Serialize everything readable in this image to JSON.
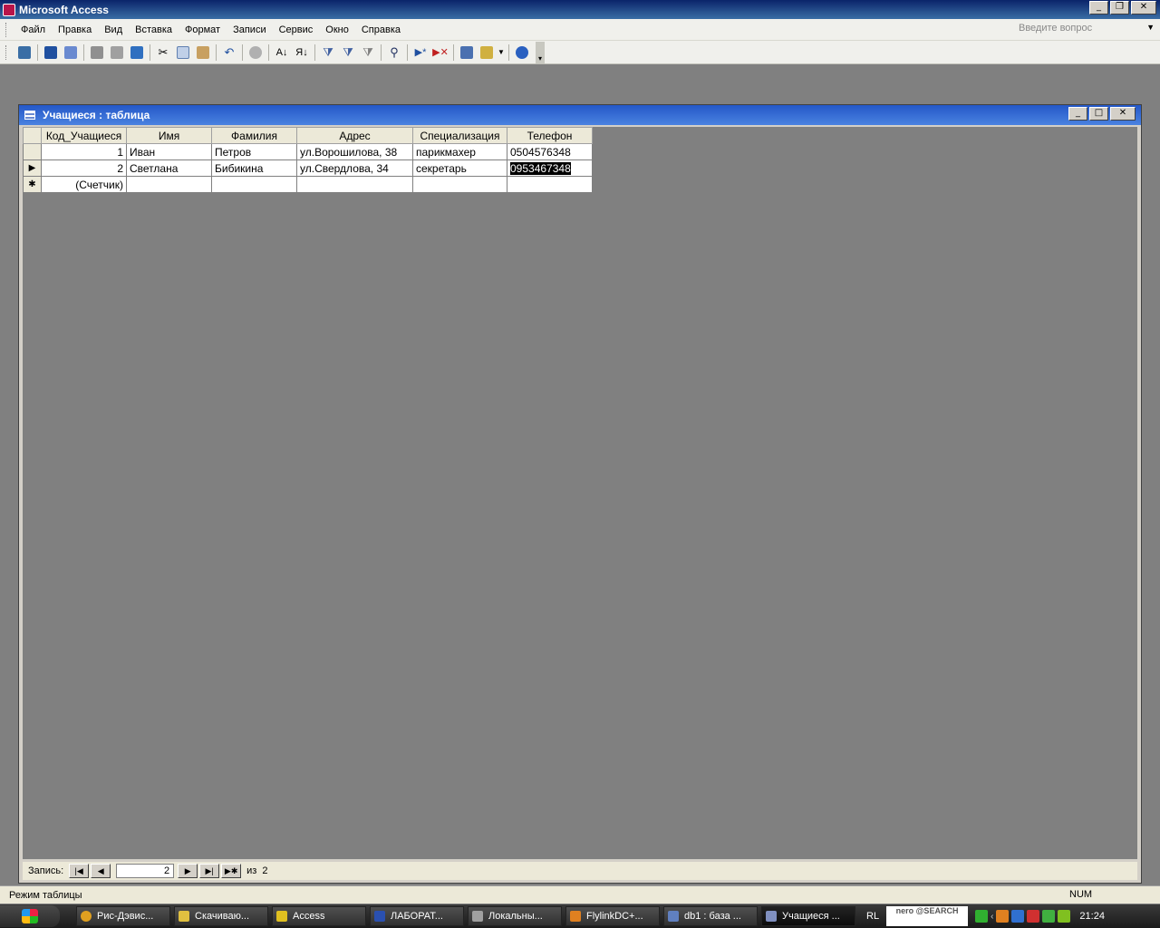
{
  "app": {
    "title": "Microsoft Access",
    "help_placeholder": "Введите вопрос"
  },
  "menu": [
    "Файл",
    "Правка",
    "Вид",
    "Вставка",
    "Формат",
    "Записи",
    "Сервис",
    "Окно",
    "Справка"
  ],
  "toolbar": {
    "icons": [
      "view-icon",
      "save-icon",
      "search-file-icon",
      "print-icon",
      "print-preview-icon",
      "spelling-icon",
      "cut-icon",
      "copy-icon",
      "paste-icon",
      "undo-icon",
      "hyperlink-icon",
      "sort-asc-icon",
      "sort-desc-icon",
      "filter-selection-icon",
      "filter-form-icon",
      "apply-filter-icon",
      "find-icon",
      "new-record-icon",
      "delete-record-icon",
      "database-window-icon",
      "new-object-icon",
      "help-icon"
    ]
  },
  "child_window": {
    "title": "Учащиеся : таблица"
  },
  "table": {
    "columns": [
      "Код_Учащиеся",
      "Имя",
      "Фамилия",
      "Адрес",
      "Специализация",
      "Телефон"
    ],
    "rows": [
      {
        "id": "1",
        "name": "Иван",
        "surname": "Петров",
        "address": "ул.Ворошилова, 38",
        "spec": "парикмахер",
        "phone": "0504576348"
      },
      {
        "id": "2",
        "name": "Светлана",
        "surname": "Бибикина",
        "address": "ул.Свердлова, 34",
        "spec": "секретарь",
        "phone": "0953467348"
      }
    ],
    "new_row_placeholder": "(Счетчик)"
  },
  "navigation": {
    "label": "Запись:",
    "current": "2",
    "of_label": "из",
    "total": "2"
  },
  "statusbar": {
    "mode": "Режим таблицы",
    "num": "NUM"
  },
  "taskbar": {
    "items": [
      "Рис-Дэвис...",
      "Скачиваю...",
      "Access",
      "ЛАБОРАТ...",
      "Локальны...",
      "FlylinkDC+...",
      "db1 : база ...",
      "Учащиеся ..."
    ],
    "lang": "RL",
    "nero": "nero @SEARCH",
    "clock": "21:24"
  }
}
